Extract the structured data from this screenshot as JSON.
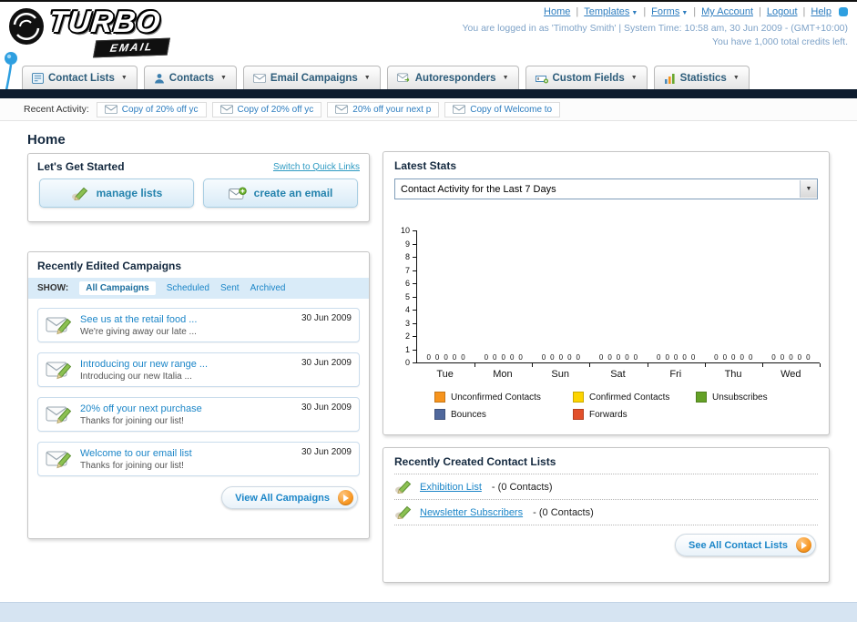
{
  "header": {
    "logo_line1": "TURBO",
    "logo_line2": "EMAIL",
    "nav_links": [
      {
        "label": "Home",
        "dropdown": false
      },
      {
        "label": "Templates",
        "dropdown": true
      },
      {
        "label": "Forms",
        "dropdown": true
      },
      {
        "label": "My Account",
        "dropdown": false
      },
      {
        "label": "Logout",
        "dropdown": false
      },
      {
        "label": "Help",
        "dropdown": false
      }
    ],
    "login_info": "You are logged in as 'Timothy Smith' | System Time: 10:58 am, 30 Jun 2009 - (GMT+10:00)",
    "credits_info": "You have 1,000 total credits left."
  },
  "nav_tabs": [
    {
      "label": "Contact Lists",
      "icon": "contact-lists"
    },
    {
      "label": "Contacts",
      "icon": "contacts"
    },
    {
      "label": "Email Campaigns",
      "icon": "email"
    },
    {
      "label": "Autoresponders",
      "icon": "autoresponder"
    },
    {
      "label": "Custom Fields",
      "icon": "custom-fields"
    },
    {
      "label": "Statistics",
      "icon": "statistics"
    }
  ],
  "recent_activity": {
    "label": "Recent Activity:",
    "items": [
      "Copy of 20% off yc",
      "Copy of 20% off yc",
      "20% off your next p",
      "Copy of Welcome to"
    ]
  },
  "page_title": "Home",
  "get_started": {
    "title": "Let's Get Started",
    "switch_link": "Switch to Quick Links",
    "buttons": [
      "manage lists",
      "create an email"
    ]
  },
  "campaigns": {
    "title": "Recently Edited Campaigns",
    "show_label": "SHOW:",
    "filters": [
      "All Campaigns",
      "Scheduled",
      "Sent",
      "Archived"
    ],
    "selected_filter": "All Campaigns",
    "items": [
      {
        "title": "See us at the retail food ...",
        "subtitle": "We're giving away our late ...",
        "date": "30 Jun 2009"
      },
      {
        "title": "Introducing our new range ...",
        "subtitle": "Introducing our new Italia ...",
        "date": "30 Jun 2009"
      },
      {
        "title": "20% off your next purchase",
        "subtitle": "Thanks for joining our list!",
        "date": "30 Jun 2009"
      },
      {
        "title": "Welcome to our email list",
        "subtitle": "Thanks for joining our list!",
        "date": "30 Jun 2009"
      }
    ],
    "view_all_label": "View All Campaigns"
  },
  "stats": {
    "title": "Latest Stats",
    "dropdown_value": "Contact Activity for the Last 7 Days",
    "chart_data": {
      "type": "bar",
      "title": "Contact Activity for the Last 7 Days",
      "categories": [
        "Tue",
        "Mon",
        "Sun",
        "Sat",
        "Fri",
        "Thu",
        "Wed"
      ],
      "series": [
        {
          "name": "Unconfirmed Contacts",
          "color": "#f7941d",
          "values": [
            0,
            0,
            0,
            0,
            0,
            0,
            0
          ]
        },
        {
          "name": "Confirmed Contacts",
          "color": "#fdd400",
          "values": [
            0,
            0,
            0,
            0,
            0,
            0,
            0
          ]
        },
        {
          "name": "Unsubscribes",
          "color": "#64a126",
          "values": [
            0,
            0,
            0,
            0,
            0,
            0,
            0
          ]
        },
        {
          "name": "Bounces",
          "color": "#50689c",
          "values": [
            0,
            0,
            0,
            0,
            0,
            0,
            0
          ]
        },
        {
          "name": "Forwards",
          "color": "#e2502b",
          "values": [
            0,
            0,
            0,
            0,
            0,
            0,
            0
          ]
        }
      ],
      "ylim": [
        0,
        10
      ],
      "yticks": [
        10,
        9,
        8,
        7,
        6,
        5,
        4,
        3,
        2,
        1,
        0
      ],
      "grid": false,
      "legend_position": "bottom"
    }
  },
  "contact_lists": {
    "title": "Recently Created Contact Lists",
    "items": [
      {
        "name": "Exhibition List",
        "detail": "- (0 Contacts)"
      },
      {
        "name": "Newsletter Subscribers",
        "detail": "- (0 Contacts)"
      }
    ],
    "see_all_label": "See All Contact Lists"
  }
}
